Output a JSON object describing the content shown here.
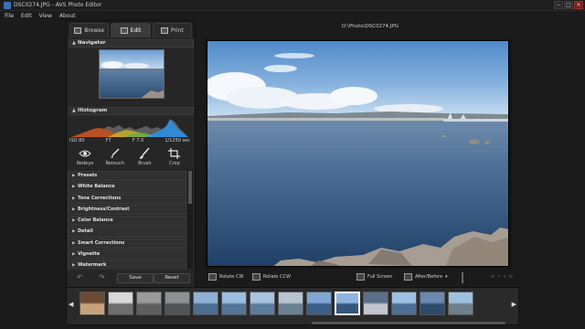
{
  "window": {
    "title": "DSC0274.JPG - AVS Photo Editor",
    "controls": [
      "–",
      "□",
      "✕"
    ]
  },
  "menu": [
    "File",
    "Edit",
    "View",
    "About"
  ],
  "tabs": [
    {
      "label": "Browse",
      "active": false
    },
    {
      "label": "Edit",
      "active": true
    },
    {
      "label": "Print",
      "active": false
    }
  ],
  "sections": {
    "navigator": "Navigator",
    "histogram": "Histogram"
  },
  "exif": {
    "iso": "ISO 80",
    "aperture1": "F7",
    "aperture2": "F 7.0",
    "shutter": "1/1250 sec"
  },
  "tools": [
    {
      "label": "Redeye",
      "icon": "eye-icon"
    },
    {
      "label": "Retouch",
      "icon": "brush-icon"
    },
    {
      "label": "Brush",
      "icon": "paintbrush-icon"
    },
    {
      "label": "Crop",
      "icon": "crop-icon"
    }
  ],
  "adjustments": [
    "Presets",
    "White Balance",
    "Tone Corrections",
    "Brightness/Contrast",
    "Color Balance",
    "Detail",
    "Smart Corrections",
    "Vignette",
    "Watermark"
  ],
  "buttons": {
    "save": "Save",
    "reset": "Reset"
  },
  "file_path": "D:\\Photo\\DSC0274.JPG",
  "viewer_toolbar": {
    "rotate_cw": "Rotate CW",
    "rotate_ccw": "Rotate CCW",
    "full_screen": "Full Screen",
    "after_before": "After/Before"
  },
  "nav_arrows": [
    "‹‹",
    "‹",
    "›",
    "››"
  ],
  "filmstrip": {
    "prev_arrow": "◀",
    "next_arrow": "▶",
    "thumbnails": [
      {
        "scene": "interior-warm",
        "selected": false
      },
      {
        "scene": "interior-white",
        "selected": false
      },
      {
        "scene": "street-grey",
        "selected": false
      },
      {
        "scene": "crowd-grey",
        "selected": false
      },
      {
        "scene": "sea-city",
        "selected": false
      },
      {
        "scene": "sea-tower",
        "selected": false
      },
      {
        "scene": "sea-boats",
        "selected": false
      },
      {
        "scene": "sea-grey",
        "selected": false
      },
      {
        "scene": "sea-blue",
        "selected": false
      },
      {
        "scene": "sea-selected",
        "selected": true
      },
      {
        "scene": "harbor-lights",
        "selected": false
      },
      {
        "scene": "sea-horizon",
        "selected": false
      },
      {
        "scene": "sea-dusk",
        "selected": false
      },
      {
        "scene": "sea-rocks",
        "selected": false
      }
    ]
  },
  "colors": {
    "background": "#1b1b1b",
    "panel": "#262626",
    "section": "#303030",
    "sky": "#8bb4dc",
    "sea": "#3b5f86"
  }
}
